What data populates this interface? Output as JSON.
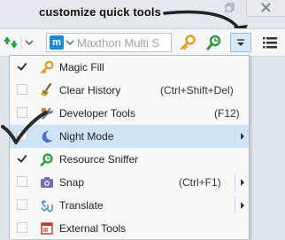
{
  "annotation": {
    "text": "customize quick tools"
  },
  "address_bar": {
    "text": "Maxthon Multi S"
  },
  "menu": {
    "items": [
      {
        "label": "Magic Fill",
        "shortcut": "",
        "checked": true,
        "highlighted": false,
        "submenu": false,
        "icon": "key-icon"
      },
      {
        "label": "Clear History",
        "shortcut": "(Ctrl+Shift+Del)",
        "checked": false,
        "highlighted": false,
        "submenu": false,
        "icon": "broom-icon"
      },
      {
        "label": "Developer Tools",
        "shortcut": "(F12)",
        "checked": false,
        "highlighted": false,
        "submenu": false,
        "icon": "wrench-icon"
      },
      {
        "label": "Night Mode",
        "shortcut": "",
        "checked": false,
        "highlighted": true,
        "submenu": true,
        "icon": "moon-icon"
      },
      {
        "label": "Resource Sniffer",
        "shortcut": "",
        "checked": true,
        "highlighted": false,
        "submenu": false,
        "icon": "sniffer-icon"
      },
      {
        "label": "Snap",
        "shortcut": "(Ctrl+F1)",
        "checked": false,
        "highlighted": false,
        "submenu": true,
        "icon": "camera-icon"
      },
      {
        "label": "Translate",
        "shortcut": "",
        "checked": false,
        "highlighted": false,
        "submenu": true,
        "icon": "translate-icon"
      },
      {
        "label": "External Tools",
        "shortcut": "",
        "checked": false,
        "highlighted": false,
        "submenu": false,
        "icon": "external-tools-icon"
      }
    ]
  },
  "colors": {
    "highlight": "#cfe3f7",
    "accent": "#1a8ad8",
    "key": "#e89a1c",
    "sniffer": "#2f9a3a"
  }
}
